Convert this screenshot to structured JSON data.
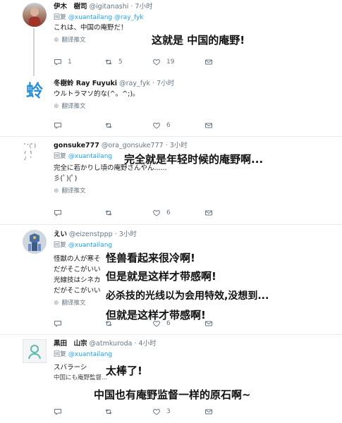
{
  "tweets": [
    {
      "name": "伊木　樹司",
      "handle": "@igitanashi",
      "time": "· 7小时",
      "reply_prefix": "回复",
      "reply_to": "@xuantailang @ray_fyk",
      "lines": [
        "これは、中国の庵野だ！"
      ],
      "translate": "翻译推文",
      "replies": "1",
      "retweets": "5",
      "likes": "19"
    },
    {
      "name": "冬樹蛉 Ray Fuyuki",
      "handle": "@ray_fyk",
      "time": "· 7小时",
      "lines": [
        "ウルトラマソ的な(^。^;)。"
      ],
      "translate": "翻译推文",
      "replies": "",
      "retweets": "",
      "likes": "6",
      "avatar_text": "蛉"
    },
    {
      "name": "gonsuke777",
      "handle": "@ora_gonsuke777",
      "time": "· 3小时",
      "reply_prefix": "回复",
      "reply_to": "@xuantailang",
      "lines": [
        "完全に若かりし頃の庵野さんやん......",
        "彡(ﾟ)(ﾟ)"
      ],
      "translate": "翻译推文",
      "replies": "",
      "retweets": "",
      "likes": "6"
    },
    {
      "name": "えい",
      "handle": "@eizenstppp",
      "time": "· 3小时",
      "reply_prefix": "回复",
      "reply_to": "@xuantailang",
      "lines": [
        "怪獣の人が寒そ",
        "だがそこがいい",
        "光線技はシネカ",
        "だがそこがいい"
      ],
      "translate": "翻译推文",
      "replies": "",
      "retweets": "",
      "likes": "6"
    },
    {
      "name": "黒田　山宗",
      "handle": "@atmkuroda",
      "time": "· 4小时",
      "reply_prefix": "回复",
      "reply_to": "@xuantailang",
      "lines": [
        "スバラーシ",
        "中国にも庵野監督..."
      ],
      "translate": "翻译推文",
      "replies": "",
      "retweets": "",
      "likes": "3"
    }
  ],
  "overlays": [
    "这就是 中国的庵野!",
    "完全就是年轻时候的庵野啊...",
    "怪兽看起来很冷啊!",
    "但是就是这样才带感啊!",
    "必杀技的光线以为会用特效,没想到...",
    "但就是这样才带感啊!",
    "太棒了!",
    "中国也有庵野监督一样的原石啊~"
  ],
  "colors": {
    "link": "#1da1f2",
    "muted": "#657786",
    "divider": "#e6ecf0"
  }
}
